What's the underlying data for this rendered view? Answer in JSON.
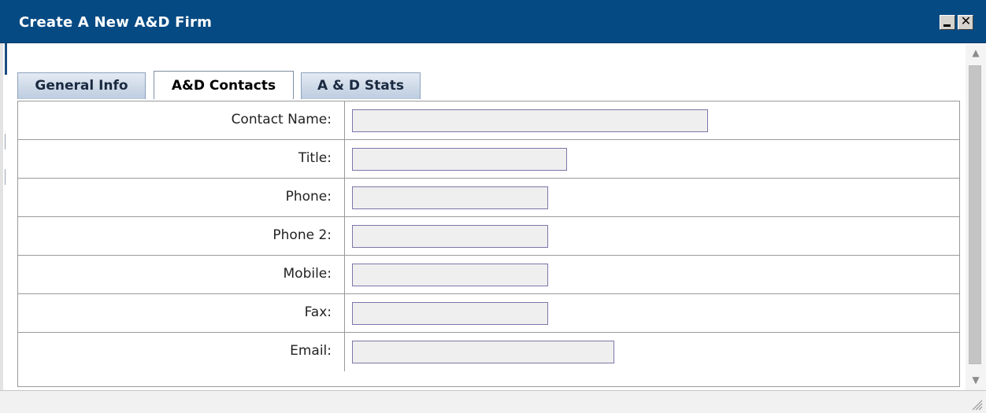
{
  "window": {
    "title": "Create A New A&D Firm",
    "minimize_icon": "minimize-icon",
    "close_icon": "close-icon",
    "close_glyph": "✕",
    "titlebar_color": "#064a83"
  },
  "tabs": [
    {
      "label": "General Info",
      "active": false
    },
    {
      "label": "A&D Contacts",
      "active": true
    },
    {
      "label": "A & D Stats",
      "active": false
    }
  ],
  "form": {
    "fields": [
      {
        "label": "Contact Name:",
        "value": ""
      },
      {
        "label": "Title:",
        "value": ""
      },
      {
        "label": "Phone:",
        "value": ""
      },
      {
        "label": "Phone 2:",
        "value": ""
      },
      {
        "label": "Mobile:",
        "value": ""
      },
      {
        "label": "Fax:",
        "value": ""
      },
      {
        "label": "Email:",
        "value": ""
      }
    ]
  },
  "scrollbar": {
    "up_icon": "scroll-up-arrow-icon",
    "down_icon": "scroll-down-arrow-icon",
    "up_glyph": "▲",
    "down_glyph": "▼"
  },
  "statusbar": {
    "grip_icon": "resize-grip-icon"
  }
}
